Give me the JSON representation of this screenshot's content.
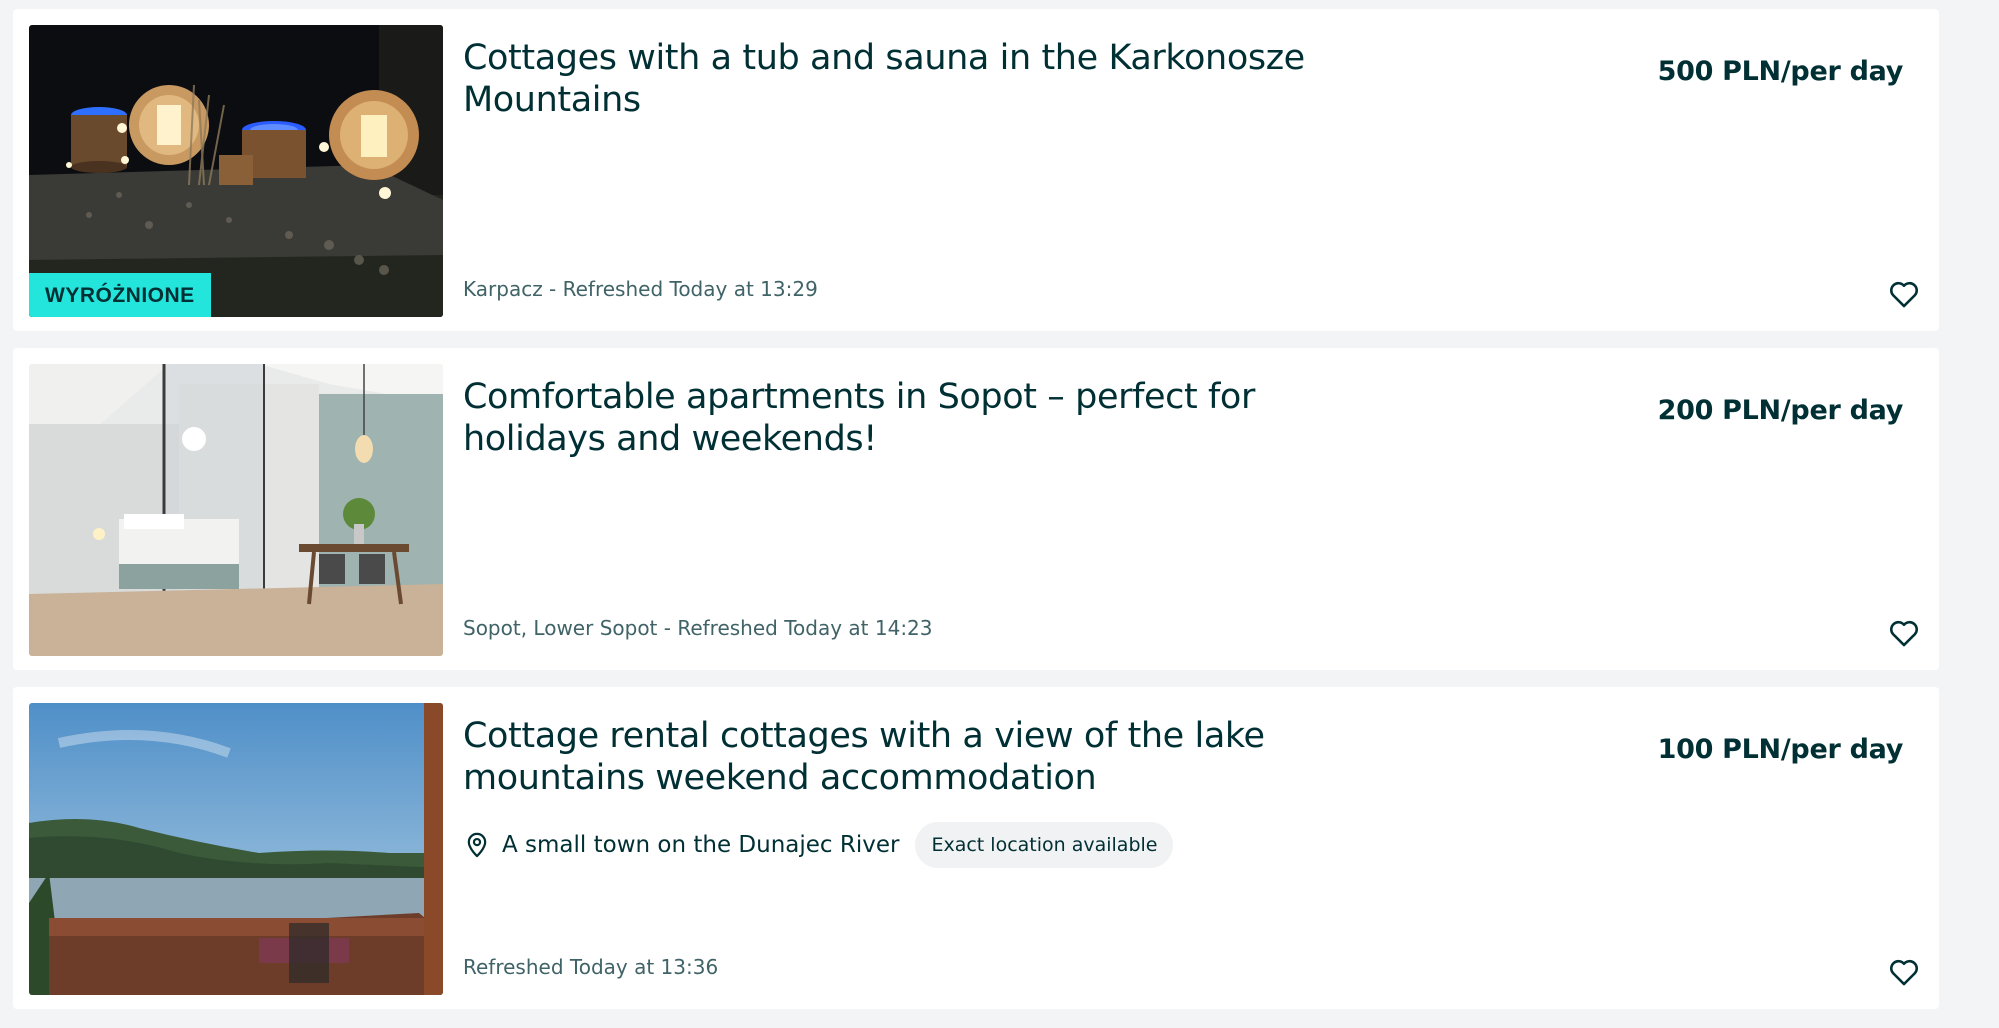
{
  "listings": [
    {
      "title": "Cottages with a tub and sauna in the Karkonosze Mountains",
      "price": "500 PLN/per day",
      "meta": "Karpacz - Refreshed Today at 13:29",
      "badge": "WYRÓŻNIONE",
      "image_icon": "night-garden-photo",
      "favorite_icon": "heart-outline-icon"
    },
    {
      "title": "Comfortable apartments in Sopot – perfect for holidays and weekends!",
      "price": "200 PLN/per day",
      "meta": "Sopot, Lower Sopot - Refreshed Today at 14:23",
      "image_icon": "apartment-interior-photo",
      "favorite_icon": "heart-outline-icon"
    },
    {
      "title": "Cottage rental cottages with a view of the lake mountains weekend accommodation",
      "price": "100 PLN/per day",
      "location": "A small town on the Dunajec River",
      "location_chip": "Exact location available",
      "meta": "Refreshed Today at 13:36",
      "image_icon": "lake-view-photo",
      "favorite_icon": "heart-outline-icon"
    }
  ],
  "colors": {
    "text_primary": "#002f34",
    "text_secondary": "#406367",
    "badge_bg": "#23e5db",
    "page_bg": "#f2f4f5",
    "card_bg": "#ffffff"
  }
}
